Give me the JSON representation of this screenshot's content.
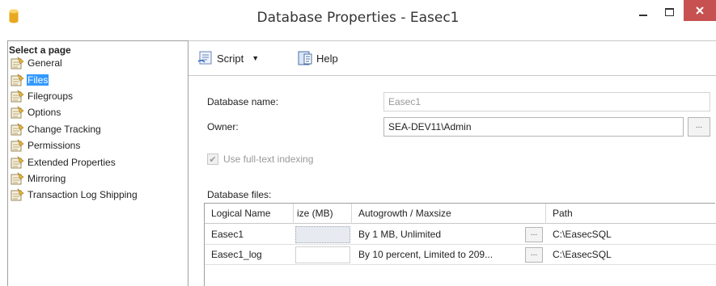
{
  "window": {
    "title": "Database Properties - Easec1",
    "close_color": "#c75050"
  },
  "sidebar": {
    "header": "Select a page",
    "items": [
      {
        "label": "General",
        "icon": "page-icon"
      },
      {
        "label": "Files",
        "icon": "page-icon",
        "selected": true
      },
      {
        "label": "Filegroups",
        "icon": "page-icon"
      },
      {
        "label": "Options",
        "icon": "page-icon"
      },
      {
        "label": "Change Tracking",
        "icon": "page-icon"
      },
      {
        "label": "Permissions",
        "icon": "page-icon"
      },
      {
        "label": "Extended Properties",
        "icon": "page-icon"
      },
      {
        "label": "Mirroring",
        "icon": "page-icon"
      },
      {
        "label": "Transaction Log Shipping",
        "icon": "page-icon"
      }
    ]
  },
  "toolbar": {
    "script_label": "Script",
    "help_label": "Help"
  },
  "form": {
    "db_name_label": "Database name:",
    "db_name_value": "Easec1",
    "owner_label": "Owner:",
    "owner_value": "SEA-DEV11\\Admin",
    "browse": "...",
    "fulltext_label": "Use full-text indexing",
    "fulltext_checked": true,
    "files_label": "Database files:"
  },
  "files_grid": {
    "columns": [
      "Logical Name",
      "ize (MB)",
      "Autogrowth / Maxsize",
      "Path"
    ],
    "rows": [
      {
        "logical_name": "Easec1",
        "size": "",
        "autogrowth": "By 1 MB, Unlimited",
        "browse": "...",
        "path": "C:\\EasecSQL"
      },
      {
        "logical_name": "Easec1_log",
        "size": "",
        "autogrowth": "By 10 percent, Limited to 209...",
        "browse": "...",
        "path": "C:\\EasecSQL"
      }
    ]
  }
}
